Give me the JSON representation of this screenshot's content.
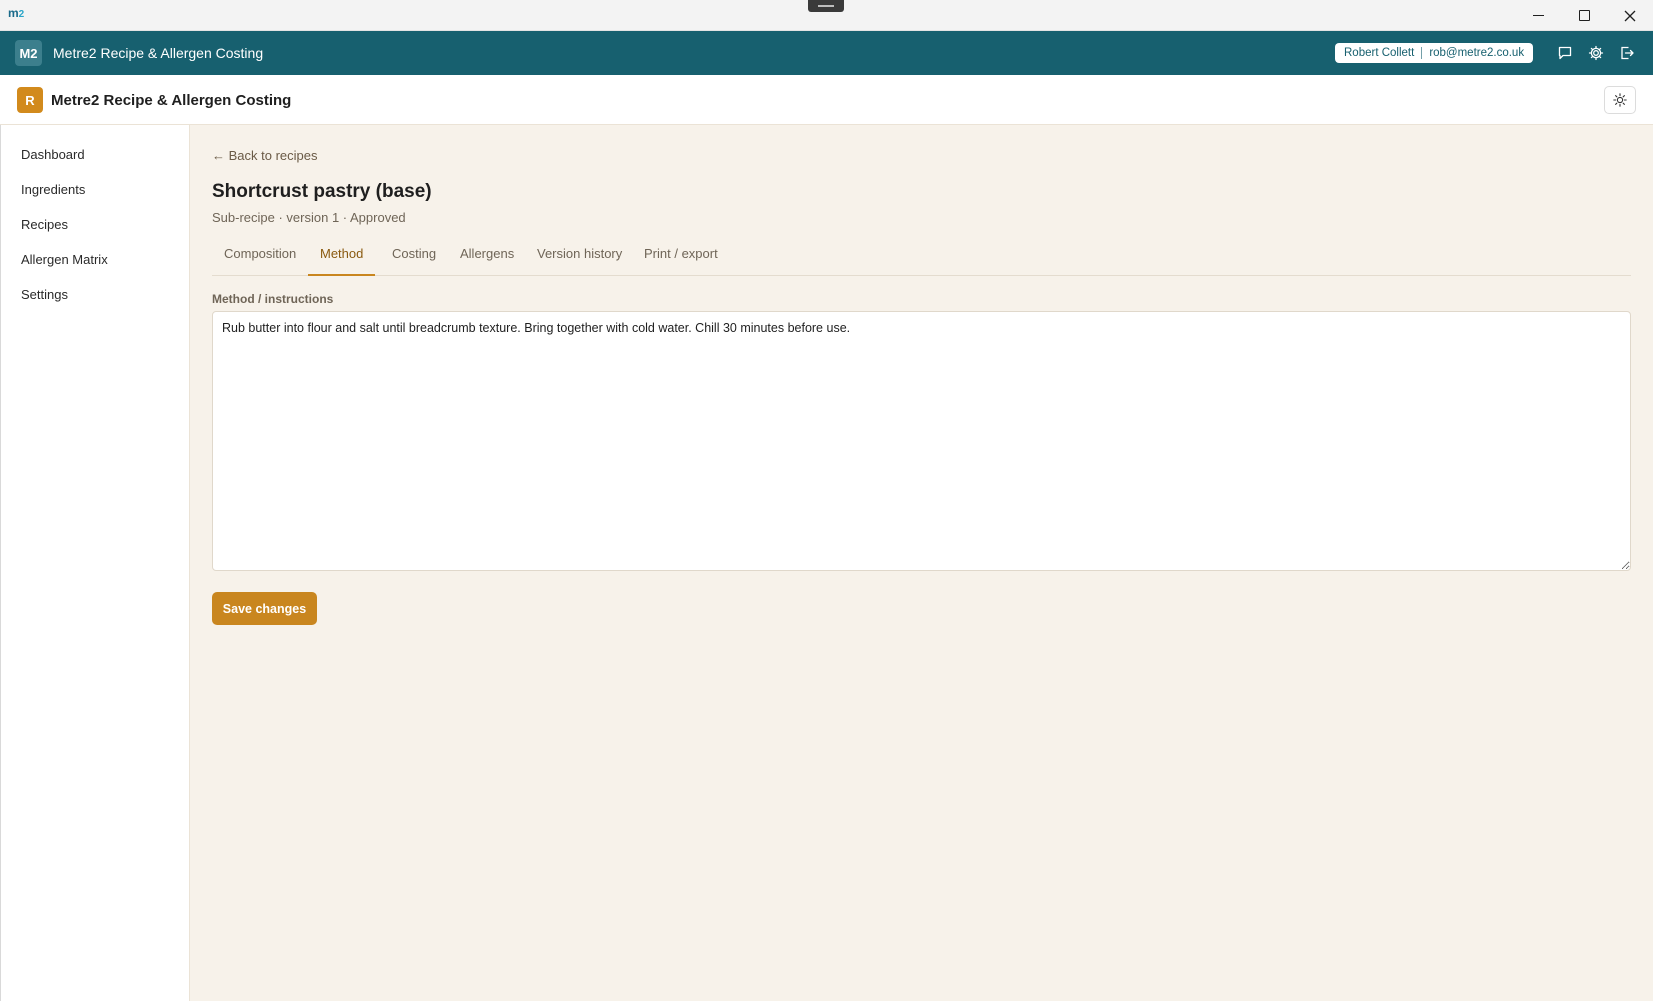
{
  "window": {
    "logo_text": "m",
    "logo_sup": "2"
  },
  "app_header": {
    "badge": "M2",
    "title": "Metre2 Recipe & Allergen Costing",
    "user_name": "Robert Collett",
    "user_email": "rob@metre2.co.uk",
    "icons": [
      "chat-icon",
      "gear-icon",
      "logout-icon"
    ]
  },
  "sub_header": {
    "badge": "R",
    "title": "Metre2 Recipe & Allergen Costing",
    "theme_icon": "sun-icon"
  },
  "sidebar": {
    "items": [
      {
        "label": "Dashboard"
      },
      {
        "label": "Ingredients"
      },
      {
        "label": "Recipes"
      },
      {
        "label": "Allergen Matrix"
      },
      {
        "label": "Settings"
      }
    ]
  },
  "main": {
    "back_link": "← Back to recipes",
    "title": "Shortcrust pastry (base)",
    "subtitle": "Sub-recipe · version 1 · Approved",
    "tabs": [
      {
        "label": "Composition"
      },
      {
        "label": "Method",
        "active": true
      },
      {
        "label": "Costing"
      },
      {
        "label": "Allergens"
      },
      {
        "label": "Version history"
      },
      {
        "label": "Print / export"
      }
    ],
    "method_label": "Method / instructions",
    "method_text": "Rub butter into flour and salt until breadcrumb texture. Bring together with cold water. Chill 30 minutes before use.",
    "save_label": "Save changes"
  },
  "colors": {
    "header_teal": "#17606f",
    "accent_amber": "#c9861f",
    "page_bg": "#f7f2ea"
  }
}
